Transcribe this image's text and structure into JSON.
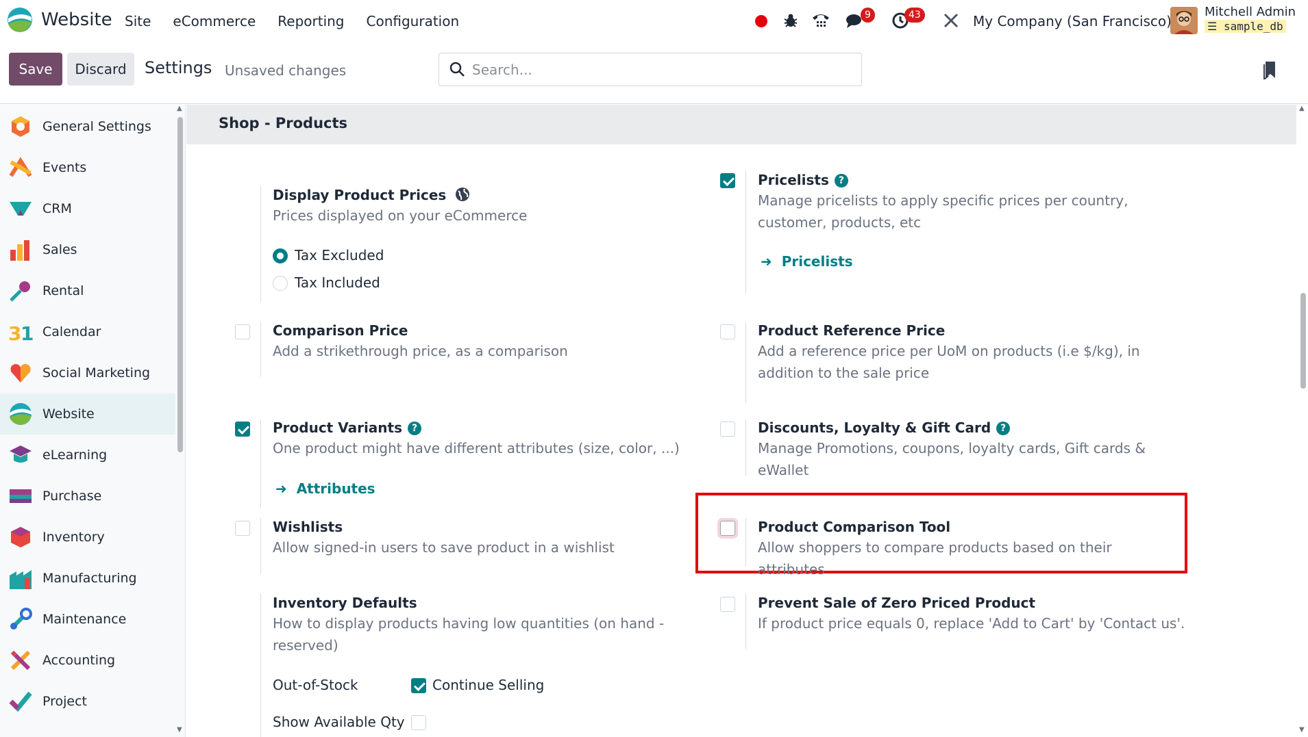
{
  "navbar": {
    "app_name": "Website",
    "menu": [
      "Site",
      "eCommerce",
      "Reporting",
      "Configuration"
    ],
    "messages_badge": "9",
    "activities_badge": "43",
    "company": "My Company (San Francisco)",
    "user_name": "Mitchell Admin",
    "database": "sample_db"
  },
  "control_panel": {
    "save_label": "Save",
    "discard_label": "Discard",
    "title": "Settings",
    "status": "Unsaved changes",
    "search_placeholder": "Search..."
  },
  "sidebar": {
    "active": "Website",
    "items": [
      {
        "label": "General Settings",
        "icon": "general-settings-icon"
      },
      {
        "label": "Events",
        "icon": "events-icon"
      },
      {
        "label": "CRM",
        "icon": "crm-icon"
      },
      {
        "label": "Sales",
        "icon": "sales-icon"
      },
      {
        "label": "Rental",
        "icon": "rental-icon"
      },
      {
        "label": "Calendar",
        "icon": "calendar-icon"
      },
      {
        "label": "Social Marketing",
        "icon": "social-marketing-icon"
      },
      {
        "label": "Website",
        "icon": "website-icon"
      },
      {
        "label": "eLearning",
        "icon": "elearning-icon"
      },
      {
        "label": "Purchase",
        "icon": "purchase-icon"
      },
      {
        "label": "Inventory",
        "icon": "inventory-icon"
      },
      {
        "label": "Manufacturing",
        "icon": "manufacturing-icon"
      },
      {
        "label": "Maintenance",
        "icon": "maintenance-icon"
      },
      {
        "label": "Accounting",
        "icon": "accounting-icon"
      },
      {
        "label": "Project",
        "icon": "project-icon"
      }
    ]
  },
  "section": {
    "title": "Shop - Products"
  },
  "settings": {
    "display_prices": {
      "title": "Display Product Prices",
      "desc": "Prices displayed on your eCommerce",
      "options": [
        "Tax Excluded",
        "Tax Included"
      ],
      "selected": "Tax Excluded"
    },
    "pricelists": {
      "title": "Pricelists",
      "checked": true,
      "desc": "Manage pricelists to apply specific prices per country, customer, products, etc",
      "link": "Pricelists"
    },
    "comparison_price": {
      "title": "Comparison Price",
      "checked": false,
      "desc": "Add a strikethrough price, as a comparison"
    },
    "reference_price": {
      "title": "Product Reference Price",
      "checked": false,
      "desc": "Add a reference price per UoM on products (i.e $/kg), in addition to the sale price"
    },
    "variants": {
      "title": "Product Variants",
      "checked": true,
      "desc": "One product might have different attributes (size, color, ...)",
      "link": "Attributes"
    },
    "discounts": {
      "title": "Discounts, Loyalty & Gift Card",
      "checked": false,
      "desc": "Manage Promotions, coupons, loyalty cards, Gift cards & eWallet"
    },
    "wishlists": {
      "title": "Wishlists",
      "checked": false,
      "desc": "Allow signed-in users to save product in a wishlist"
    },
    "comparison_tool": {
      "title": "Product Comparison Tool",
      "checked": false,
      "desc": "Allow shoppers to compare products based on their attributes"
    },
    "inventory_defaults": {
      "title": "Inventory Defaults",
      "desc": "How to display products having low quantities (on hand - reserved)",
      "out_of_stock_label": "Out-of-Stock",
      "continue_selling_label": "Continue Selling",
      "continue_selling_checked": true,
      "show_qty_label": "Show Available Qty",
      "show_qty_checked": false
    },
    "zero_price": {
      "title": "Prevent Sale of Zero Priced Product",
      "checked": false,
      "desc": "If product price equals 0, replace 'Add to Cart' by 'Contact us'."
    }
  },
  "colors": {
    "brand": "#714b67",
    "accent": "#017e84",
    "highlight": "#e3000b",
    "badge": "#d61a1a"
  }
}
